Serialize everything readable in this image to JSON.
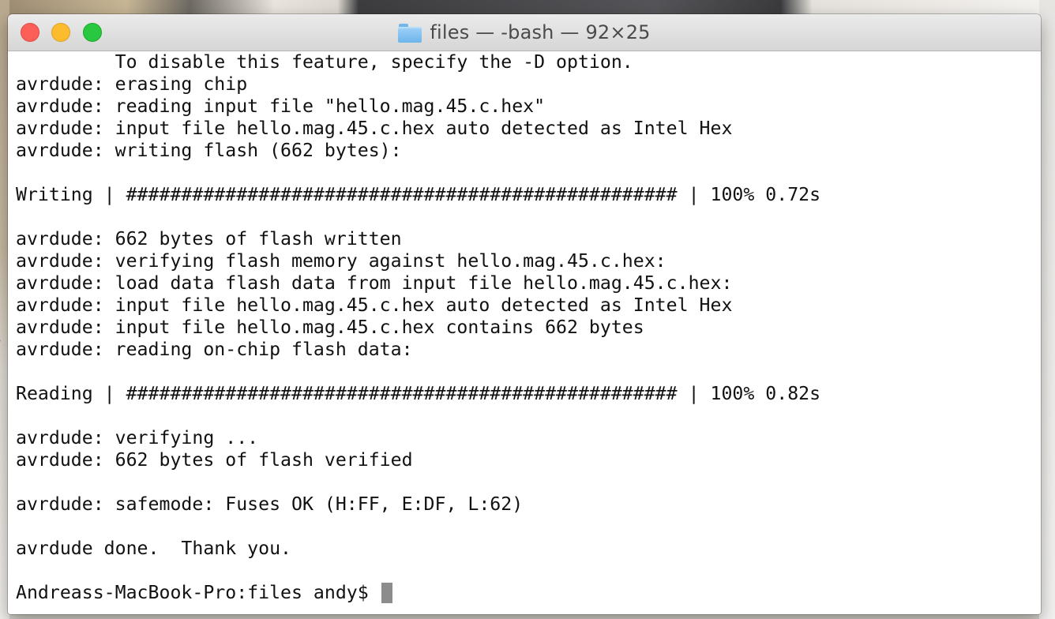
{
  "window": {
    "title": "files — -bash — 92×25"
  },
  "background": {
    "edge_text": "r"
  },
  "terminal": {
    "lines": [
      "         To disable this feature, specify the -D option.",
      "avrdude: erasing chip",
      "avrdude: reading input file \"hello.mag.45.c.hex\"",
      "avrdude: input file hello.mag.45.c.hex auto detected as Intel Hex",
      "avrdude: writing flash (662 bytes):",
      "",
      "Writing | ################################################## | 100% 0.72s",
      "",
      "avrdude: 662 bytes of flash written",
      "avrdude: verifying flash memory against hello.mag.45.c.hex:",
      "avrdude: load data flash data from input file hello.mag.45.c.hex:",
      "avrdude: input file hello.mag.45.c.hex auto detected as Intel Hex",
      "avrdude: input file hello.mag.45.c.hex contains 662 bytes",
      "avrdude: reading on-chip flash data:",
      "",
      "Reading | ################################################## | 100% 0.82s",
      "",
      "avrdude: verifying ...",
      "avrdude: 662 bytes of flash verified",
      "",
      "avrdude: safemode: Fuses OK (H:FF, E:DF, L:62)",
      "",
      "avrdude done.  Thank you.",
      ""
    ],
    "prompt": "Andreass-MacBook-Pro:files andy$ "
  },
  "colors": {
    "close": "#fc5f57",
    "minimize": "#fdbc2e",
    "zoom": "#28c840",
    "folder": "#6db4ec",
    "cursor": "#8c8c8c"
  },
  "icons": {
    "title_icon": "folder-icon"
  }
}
